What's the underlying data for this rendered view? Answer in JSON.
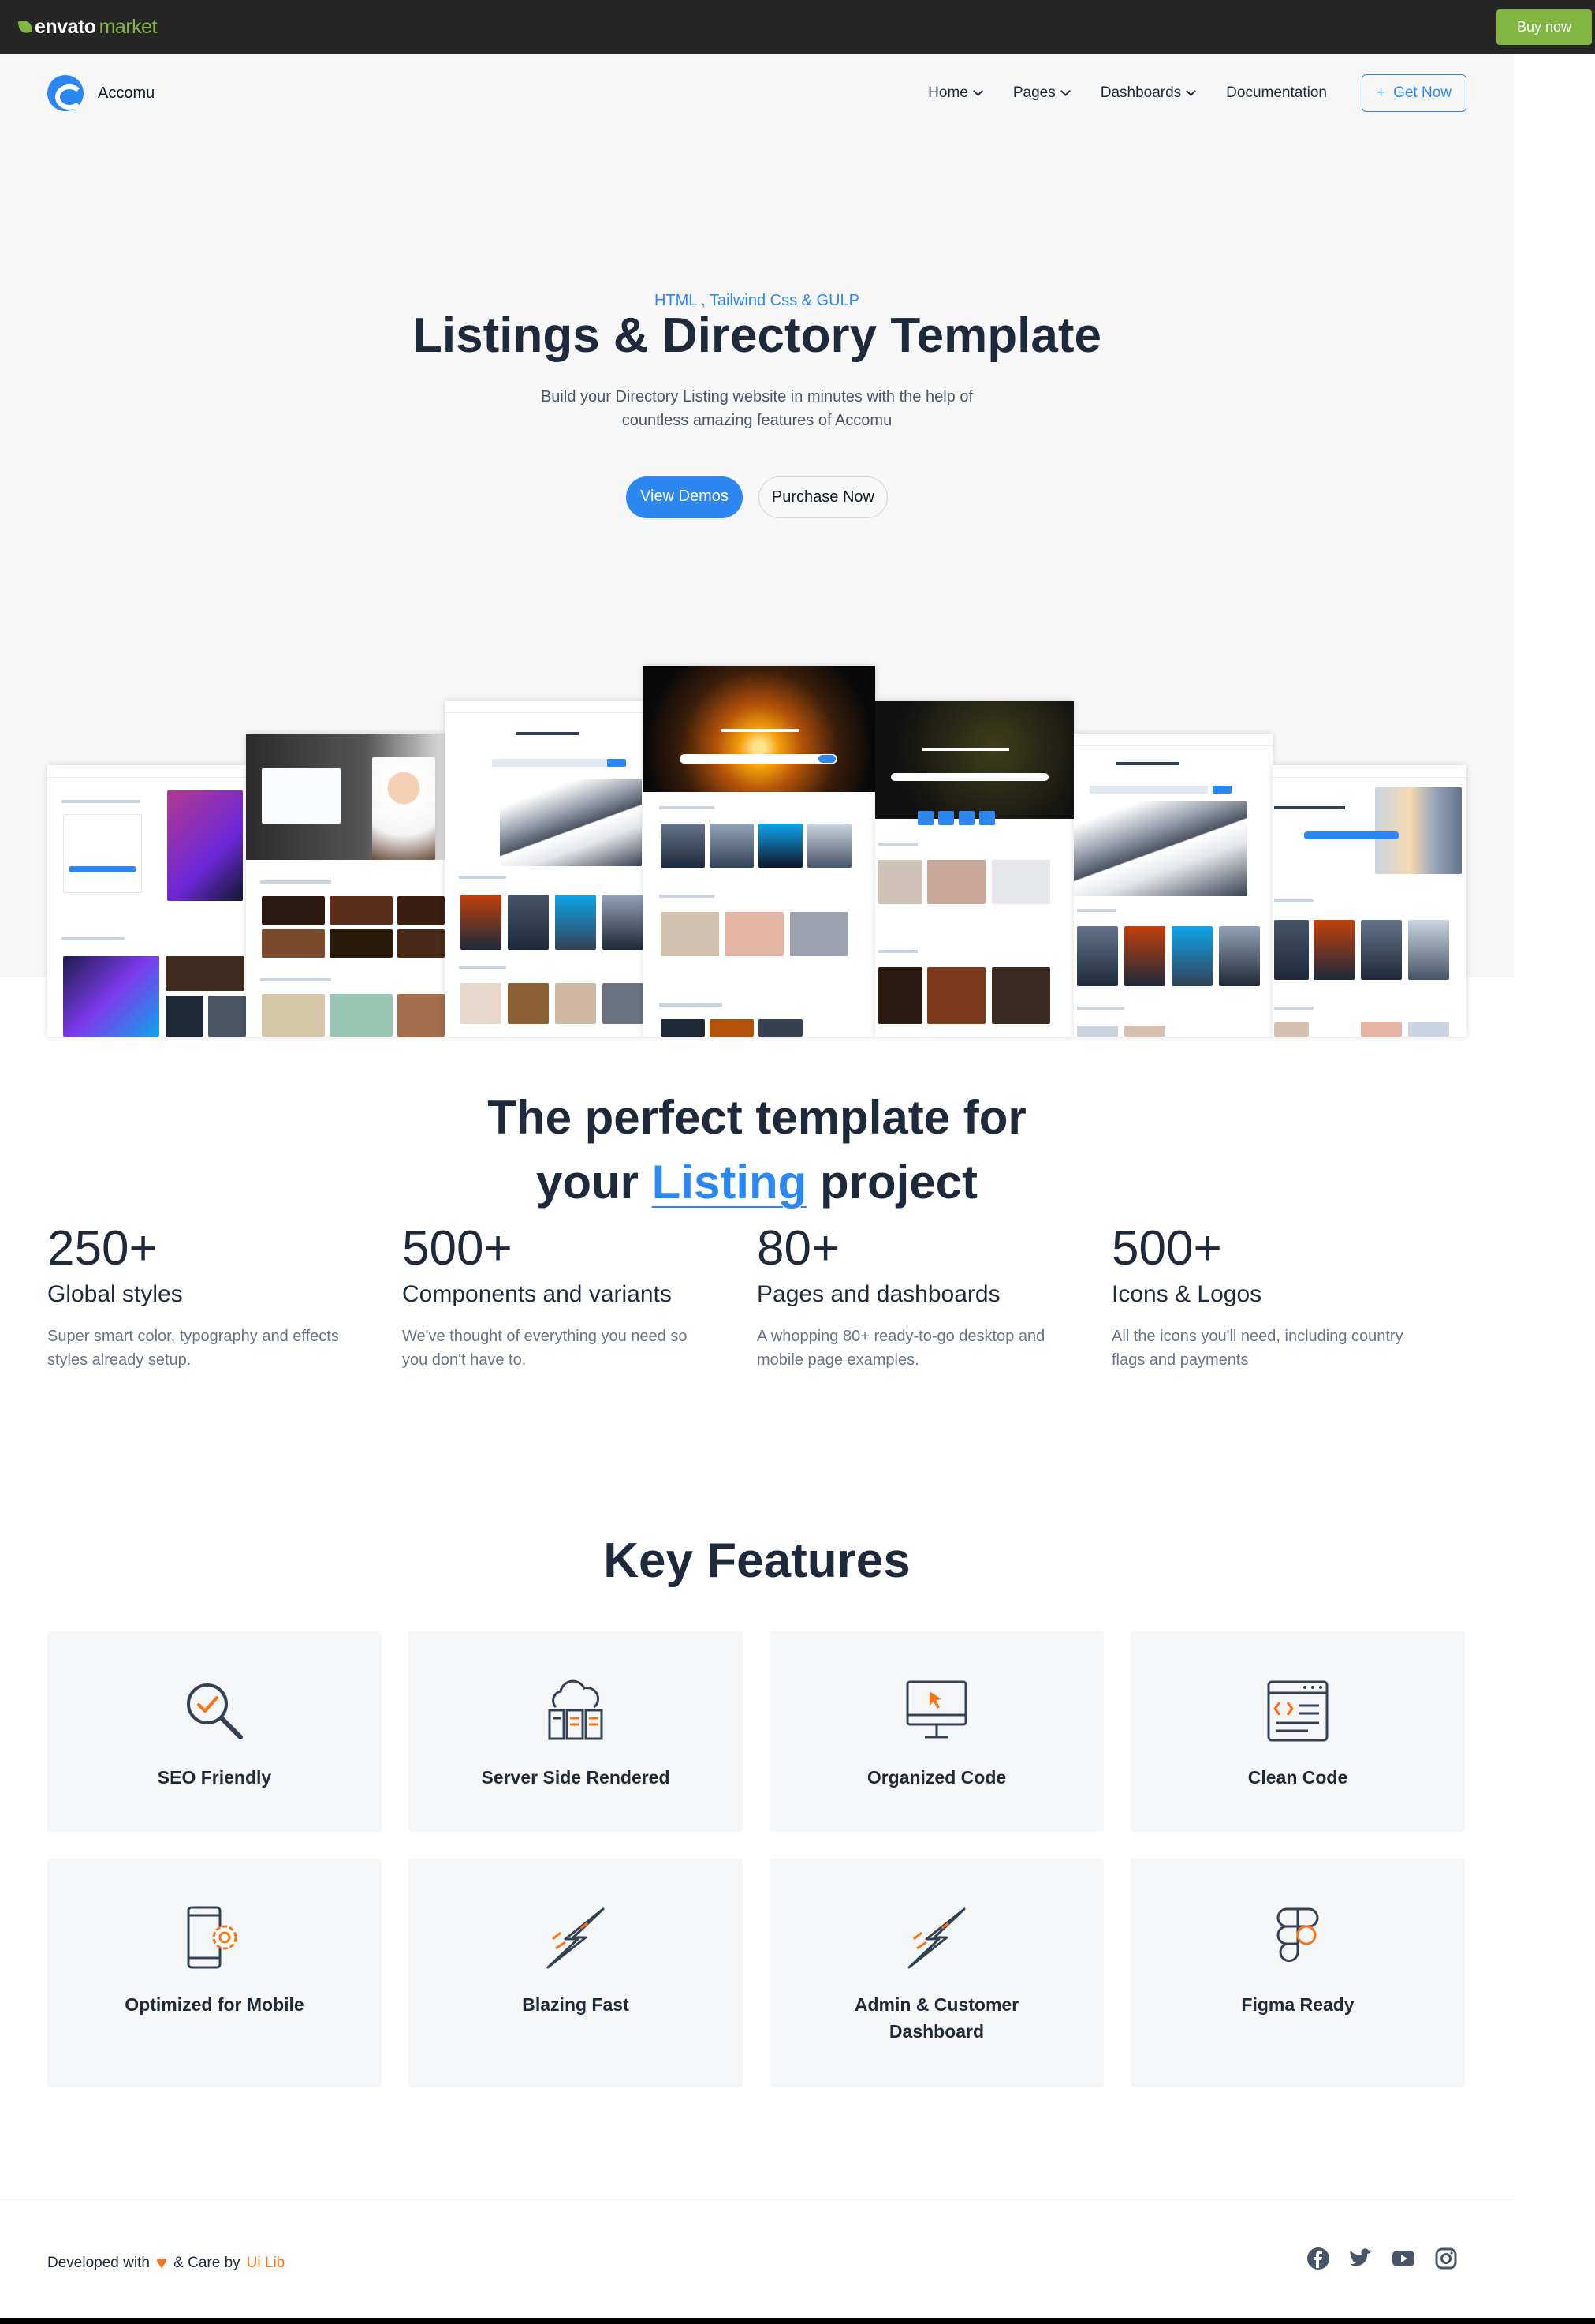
{
  "envato": {
    "logo_main": "envato",
    "logo_sub": "market",
    "buy_label": "Buy now"
  },
  "nav": {
    "brand": "Accomu",
    "links": [
      "Home",
      "Pages",
      "Dashboards",
      "Documentation"
    ],
    "cta": "Get Now"
  },
  "hero": {
    "tagline": "HTML , Tailwind Css & GULP",
    "title": "Listings & Directory Template",
    "subtitle": "Build your Directory Listing website in minutes with the help of countless amazing features of Accomu",
    "primary_btn": "View Demos",
    "secondary_btn": "Purchase Now"
  },
  "perfect": {
    "line1": "The perfect template for",
    "pre": "your",
    "accent": "Listing",
    "post": "project"
  },
  "stats": [
    {
      "num": "250+",
      "label": "Global styles",
      "desc": "Super smart color, typography and effects styles already setup."
    },
    {
      "num": "500+",
      "label": "Components and variants",
      "desc": "We've thought of everything you need so you don't have to."
    },
    {
      "num": "80+",
      "label": "Pages and dashboards",
      "desc": "A whopping 80+ ready-to-go desktop and mobile page examples."
    },
    {
      "num": "500+",
      "label": "Icons & Logos",
      "desc": "All the icons you'll need, including country flags and payments"
    }
  ],
  "features_title": "Key Features",
  "features": [
    {
      "label": "SEO Friendly",
      "icon": "seo-magnifier-icon"
    },
    {
      "label": "Server Side Rendered",
      "icon": "cloud-server-icon"
    },
    {
      "label": "Organized Code",
      "icon": "monitor-cursor-icon"
    },
    {
      "label": "Clean Code",
      "icon": "code-window-icon"
    },
    {
      "label": "Optimized for Mobile",
      "icon": "mobile-gear-icon"
    },
    {
      "label": "Blazing Fast",
      "icon": "lightning-icon"
    },
    {
      "label": "Admin & Customer Dashboard",
      "icon": "lightning-icon"
    },
    {
      "label": "Figma Ready",
      "icon": "figma-icon"
    }
  ],
  "footer": {
    "developed": "Developed with",
    "care": "& Care by",
    "author": "Ui Lib",
    "socials": [
      "facebook-icon",
      "twitter-icon",
      "youtube-icon",
      "instagram-icon"
    ]
  },
  "colors": {
    "accent": "#2d87f0",
    "envato_green": "#82b541",
    "orange": "#f97316"
  }
}
